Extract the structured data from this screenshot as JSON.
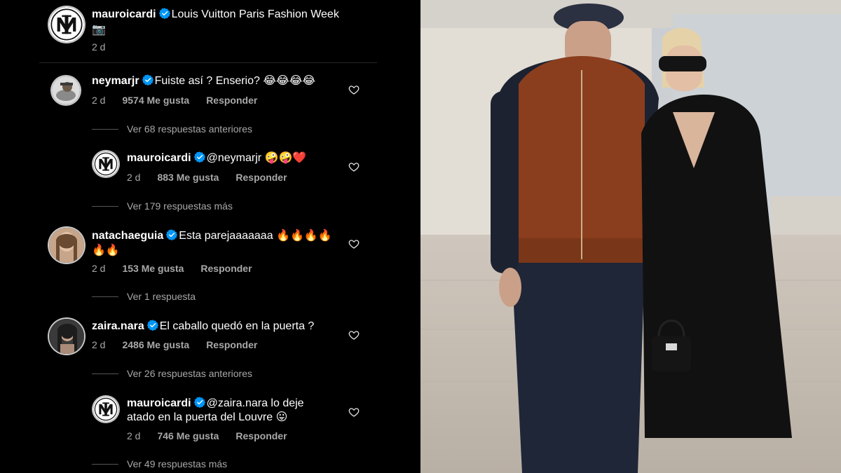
{
  "post": {
    "username": "mauroicardi",
    "caption": "Louis Vuitton Paris Fashion Week",
    "caption_emoji": "📷",
    "time": "2 d"
  },
  "comments": [
    {
      "username": "neymarjr",
      "text": "Fuiste así ? Enserio? 😂😂😂😂",
      "time": "2 d",
      "likes": "9574 Me gusta",
      "reply": "Responder"
    },
    {
      "username": "mauroicardi",
      "text": "@neymarjr 🤪🤪❤️",
      "time": "2 d",
      "likes": "883 Me gusta",
      "reply": "Responder"
    },
    {
      "username": "natachaeguia",
      "text": "Esta parejaaaaaaa 🔥🔥🔥🔥",
      "text2": "🔥🔥",
      "time": "2 d",
      "likes": "153 Me gusta",
      "reply": "Responder"
    },
    {
      "username": "zaira.nara",
      "text": "El caballo quedó en la puerta ?",
      "time": "2 d",
      "likes": "2486 Me gusta",
      "reply": "Responder"
    },
    {
      "username": "mauroicardi",
      "text": "@zaira.nara lo deje",
      "text2": "atado en la puerta del Louvre 😛",
      "time": "2 d",
      "likes": "746 Me gusta",
      "reply": "Responder"
    }
  ],
  "more_links": [
    "Ver 68 respuestas anteriores",
    "Ver 179 respuestas más",
    "Ver 1 respuesta",
    "Ver 26 respuestas anteriores",
    "Ver 49 respuestas más"
  ],
  "colors": {
    "background": "#000000",
    "text": "#ffffff",
    "muted": "#a8a8a8",
    "verified": "#0095f6"
  },
  "icons": [
    "verified-badge-icon",
    "heart-icon",
    "camera-emoji-icon"
  ]
}
